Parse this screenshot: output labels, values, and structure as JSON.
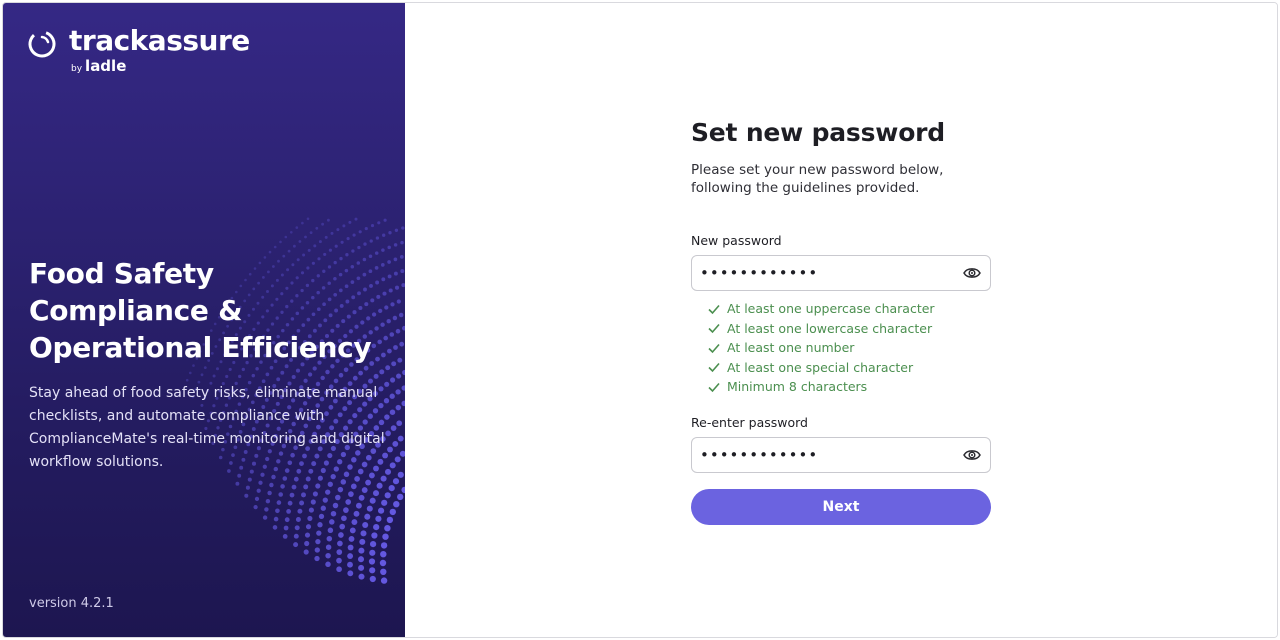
{
  "brand": {
    "name": "trackassure",
    "by_prefix": "by",
    "by_name": "ladle",
    "headline_lines": [
      "Food Safety",
      "Compliance &",
      "Operational Efficiency"
    ],
    "description": "Stay ahead of food safety risks, eliminate manual checklists, and automate compliance with ComplianceMate's real-time monitoring and digital workflow solutions.",
    "version": "version 4.2.1",
    "colors": {
      "panel_top": "#352885",
      "panel_bottom": "#1d1650",
      "dot_accent": "#6b5ff0"
    }
  },
  "form": {
    "title": "Set new password",
    "subtitle": "Please set your new password below, following the guidelines provided.",
    "new_password": {
      "label": "New password",
      "value": "••••••••••••",
      "icon": "eye-icon"
    },
    "rules": [
      "At least one uppercase character",
      "At least one lowercase character",
      "At least one number",
      "At least one special character",
      "Minimum 8 characters"
    ],
    "reenter_password": {
      "label": "Re-enter password",
      "value": "••••••••••••",
      "icon": "eye-icon"
    },
    "next_label": "Next",
    "colors": {
      "button": "#6b63e0",
      "rule_ok": "#4b8f4f"
    }
  }
}
